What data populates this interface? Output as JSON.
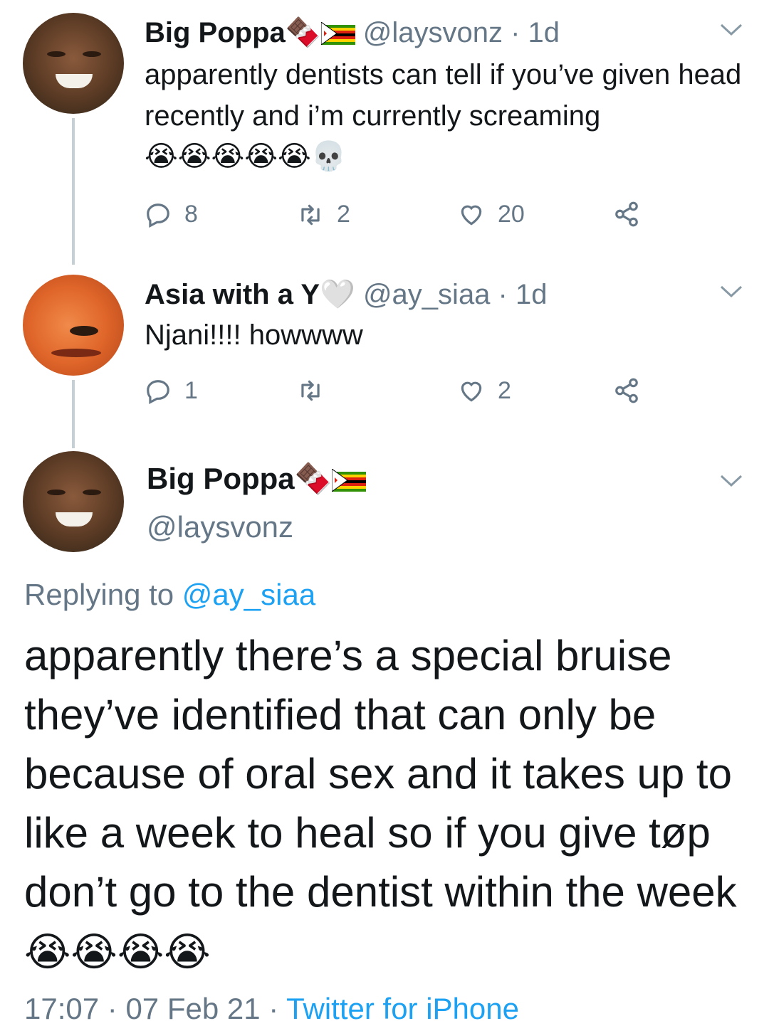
{
  "tweet1": {
    "name": "Big Poppa",
    "name_emoji": "🍫",
    "handle": "@laysvonz",
    "sep": " · ",
    "time": "1d",
    "text": "apparently dentists can tell if you’ve given head recently and i’m currently screaming",
    "emojis": "😭😭😭😭😭💀",
    "reply_count": "8",
    "retweet_count": "2",
    "like_count": "20"
  },
  "tweet2": {
    "name": "Asia with a Y",
    "name_emoji": "🤍",
    "handle": "@ay_siaa",
    "sep": " · ",
    "time": "1d",
    "text": "Njani!!!! howwww",
    "reply_count": "1",
    "retweet_count": "",
    "like_count": "2"
  },
  "main": {
    "name": "Big Poppa",
    "name_emoji": "🍫",
    "handle": "@laysvonz",
    "replying_prefix": "Replying to ",
    "replying_to": "@ay_siaa",
    "text": "apparently there’s a special bruise they’ve identified that can only be because of oral sex and it takes up to like a week to heal so if you give tøp don’t go to the dentist within the week ",
    "emojis": "😭😭😭😭",
    "time": "17:07",
    "date": "07 Feb 21",
    "sep": " · ",
    "source": "Twitter for iPhone"
  },
  "icons": {
    "reply": "reply-icon",
    "retweet": "retweet-icon",
    "like": "heart-icon",
    "share": "share-icon",
    "caret": "chevron-down-icon",
    "flag": "zimbabwe-flag-icon"
  },
  "colors": {
    "text": "#14171a",
    "secondary": "#657786",
    "link": "#1da1f2",
    "thread_line": "#c4cfd6"
  }
}
